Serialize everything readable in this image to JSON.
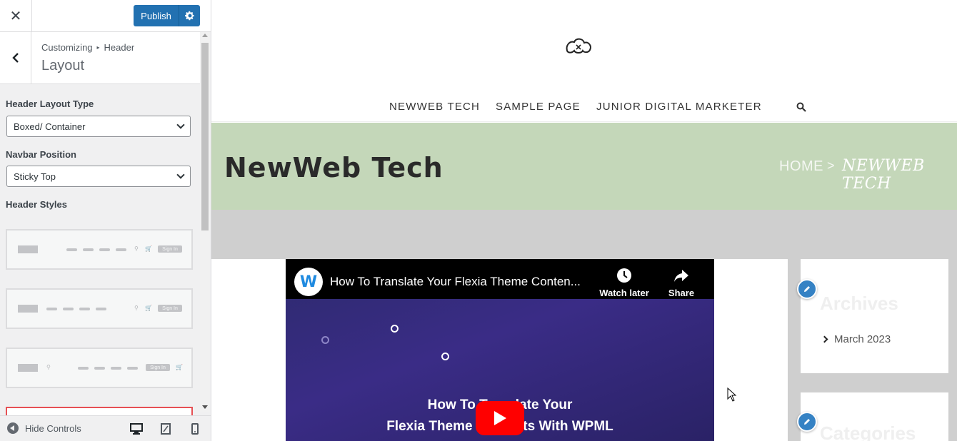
{
  "customizer": {
    "publish_label": "Publish",
    "breadcrumb": {
      "root": "Customizing",
      "parent": "Header"
    },
    "section_title": "Layout",
    "controls": {
      "header_layout_type": {
        "label": "Header Layout Type",
        "value": "Boxed/ Container"
      },
      "navbar_position": {
        "label": "Navbar Position",
        "value": "Sticky Top"
      },
      "header_styles": {
        "label": "Header Styles",
        "sign_in": "Sign In"
      }
    },
    "footer": {
      "hide_controls": "Hide Controls"
    }
  },
  "site": {
    "nav": [
      "NEWWEB TECH",
      "SAMPLE PAGE",
      "JUNIOR DIGITAL MARKETER"
    ],
    "page_title": "NewWeb Tech",
    "breadcrumb": {
      "home": "HOME",
      "separator": ">",
      "current": "NEWWEB TECH"
    },
    "title_band_color": "#c4d7b9",
    "video": {
      "title": "How To Translate Your Flexia Theme Conten...",
      "channel_initial": "W",
      "watch_later": "Watch later",
      "share": "Share",
      "caption_line1": "How To Translate Your",
      "caption_line2": "Flexia Theme Contents With WPML"
    },
    "widgets": {
      "archives": {
        "title": "Archives",
        "items": [
          "March 2023"
        ]
      },
      "categories": {
        "title": "Categories"
      }
    }
  },
  "colors": {
    "accent": "#2271b1",
    "youtube_red": "#ff0000",
    "edit_pen": "#3582c4"
  }
}
